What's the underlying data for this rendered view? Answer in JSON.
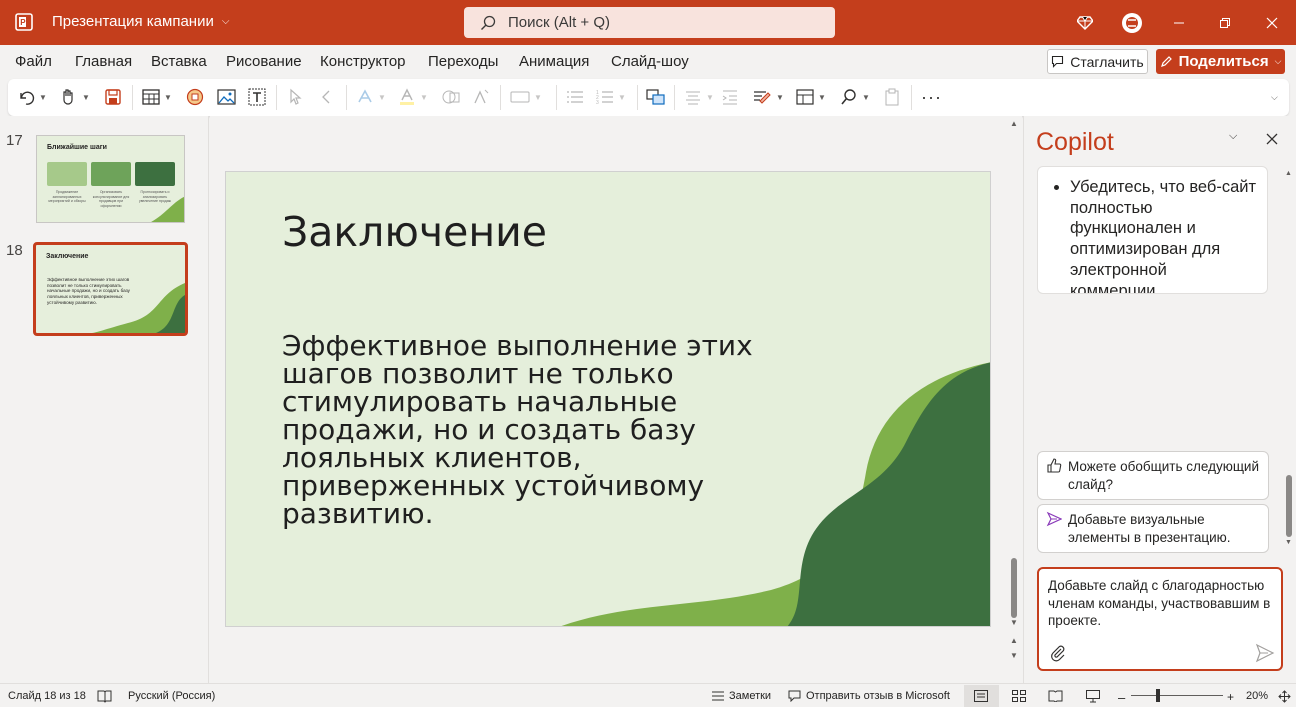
{
  "titlebar": {
    "doc_title": "Презентация кампании",
    "search_placeholder": "Поиск (Alt + Q)"
  },
  "menu": {
    "items": [
      "Файл",
      "Главная",
      "Вставка",
      "Рисование",
      "Конструктор",
      "Переходы",
      "Анимация",
      "Слайд-шоу"
    ],
    "comment_button": "Стаглачить",
    "share_button": "Поделиться"
  },
  "thumbnails": {
    "slide17": {
      "number": "17",
      "title": "Ближайшие шаги",
      "captions": [
        "Продвижение запланированных мероприятий и обзоры",
        "Организовать консультирование для продавцов при оформлении",
        "Прогнозировать и анализировать увеличение продаж"
      ]
    },
    "slide18": {
      "number": "18",
      "title": "Заключение",
      "text": "Эффективное выполнение этих шагов позволит не только стимулировать начальные продажи, но и создать базу лояльных клиентов, приверженных устойчивому развитию."
    }
  },
  "slide": {
    "title": "Заключение",
    "body": "Эффективное выполнение этих шагов позволит не только стимулировать начальные продажи, но и создать базу лояльных клиентов, приверженных устойчивому развитию."
  },
  "copilot": {
    "title": "Copilot",
    "bullet_text": "Убедитесь, что веб-сайт полностью функционален и оптимизирован для электронной коммерции.",
    "suggestions": [
      "Можете обобщить следующий слайд?",
      "Добавьте визуальные элементы в презентацию."
    ],
    "input_text": "Добавьте слайд с благодарностью членам команды, участвовавшим в проекте."
  },
  "status": {
    "slide_counter": "Слайд 18 из 18",
    "language": "Русский (Россия)",
    "notes": "Заметки",
    "feedback": "Отправить отзыв в Microsoft",
    "zoom": "20%"
  },
  "colors": {
    "accent": "#c43e1c",
    "slide_bg": "#e5efdb",
    "wave_dark": "#3d7040",
    "wave_light": "#7fb04a"
  }
}
